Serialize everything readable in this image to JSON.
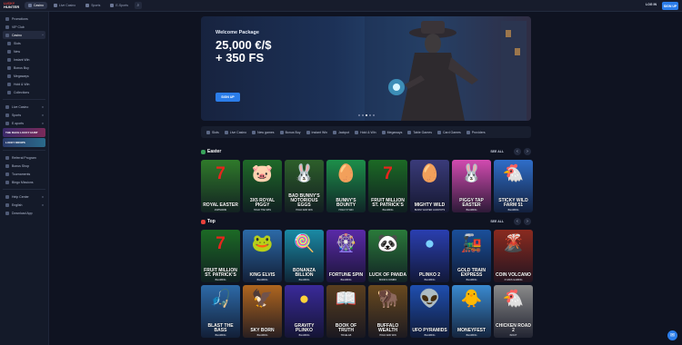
{
  "header": {
    "logo_top": "LUCKY",
    "logo_bottom": "HUNTER",
    "tabs": [
      {
        "label": "Casino",
        "active": true
      },
      {
        "label": "Live Casino",
        "active": false
      },
      {
        "label": "Sports",
        "active": false
      },
      {
        "label": "E-Sports",
        "active": false
      }
    ],
    "login_label": "LOG IN",
    "signup_label": "SIGN UP"
  },
  "sidebar": {
    "items": [
      {
        "label": "Promotions"
      },
      {
        "label": "VIP Club"
      },
      {
        "label": "Casino",
        "active": true,
        "chevron": "^"
      },
      {
        "label": "Slots",
        "sub": true
      },
      {
        "label": "New",
        "sub": true
      },
      {
        "label": "Instant Win",
        "sub": true
      },
      {
        "label": "Bonus Buy",
        "sub": true
      },
      {
        "label": "Megaways",
        "sub": true
      },
      {
        "label": "Hold & Win",
        "sub": true
      },
      {
        "label": "Collections",
        "sub": true
      }
    ],
    "items2": [
      {
        "label": "Live Casino",
        "chevron": "v"
      },
      {
        "label": "Sports",
        "chevron": "v"
      },
      {
        "label": "E-sports",
        "chevron": "v"
      }
    ],
    "promo1": "THE RACE   LUCKY HUNT",
    "promo2": "LUCKY DROPS",
    "items3": [
      {
        "label": "Referral Program"
      },
      {
        "label": "Bonus Shop"
      },
      {
        "label": "Tournaments"
      },
      {
        "label": "Bingo Missions"
      }
    ],
    "items4": [
      {
        "label": "Help Center",
        "chevron": "v"
      },
      {
        "label": "English",
        "chevron": "v"
      },
      {
        "label": "Download App"
      }
    ]
  },
  "hero": {
    "subtitle": "Welcome Package",
    "headline": "25,000 €/$\n+ 350 FS",
    "cta": "SIGN UP"
  },
  "filters": [
    "Slots",
    "Live Casino",
    "New games",
    "Bonus Buy",
    "Instant Win",
    "Jackpot",
    "Hold & Win",
    "Megaways",
    "Table Games",
    "Card Games",
    "Providers"
  ],
  "sections": {
    "easter": {
      "title": "Easter",
      "see_all": "SEE ALL"
    },
    "top": {
      "title": "Top",
      "see_all": "SEE ALL"
    }
  },
  "easter_games": [
    {
      "name": "ROYAL EASTER",
      "provider": "1SPIN4WIN",
      "glyph": "7",
      "bg": "#2f7a2a",
      "fg": "#e8251d"
    },
    {
      "name": "3X5 ROYAL PIGGY",
      "provider": "HOLD THE SPIN",
      "glyph": "🐷",
      "bg": "#1f6a28",
      "fg": "#ffd23a"
    },
    {
      "name": "BAD BUNNY'S NOTORIOUS EGGS",
      "provider": "HOLD AND WIN",
      "glyph": "🐰",
      "bg": "#2d5f2a",
      "fg": "#ffffff"
    },
    {
      "name": "BUNNY'S BOUNTY",
      "provider": "HOLD 'N' WIN",
      "glyph": "🥚",
      "bg": "#1d8f4a",
      "fg": "#f5e34a"
    },
    {
      "name": "FRUIT MILLION ST. PATRICK'S",
      "provider": "BGAMING",
      "glyph": "7",
      "bg": "#1c6a25",
      "fg": "#e8251d"
    },
    {
      "name": "MIGHTY WILD",
      "provider": "BUNNY EASTER JACKPOTS",
      "glyph": "🥚",
      "bg": "#3a3b7a",
      "fg": "#d36be0"
    },
    {
      "name": "PIGGY TAP EASTER",
      "provider": "BGAMING",
      "glyph": "🐰",
      "bg": "#d24bb0",
      "fg": "#ffffff"
    },
    {
      "name": "STICKY WILD FARM 51",
      "provider": "BGAMING",
      "glyph": "🐔",
      "bg": "#2f6ec9",
      "fg": "#ffffff"
    }
  ],
  "top_games_1": [
    {
      "name": "FRUIT MILLION ST. PATRICK'S",
      "provider": "BGAMING",
      "glyph": "7",
      "bg": "#1c6a25",
      "fg": "#e8251d"
    },
    {
      "name": "KING ELVIS",
      "provider": "BGAMING",
      "glyph": "🐸",
      "bg": "#2c6aa8",
      "fg": "#6bd14a"
    },
    {
      "name": "BONANZA BILLION",
      "provider": "BGAMING",
      "glyph": "🍭",
      "bg": "#1a8aa5",
      "fg": "#ff5aa8"
    },
    {
      "name": "FORTUNE SPIN",
      "provider": "BGAMING",
      "glyph": "🎡",
      "bg": "#5a2aa8",
      "fg": "#ffd23a"
    },
    {
      "name": "LUCK OF PANDA",
      "provider": "BONUS COMBO",
      "glyph": "🐼",
      "bg": "#2a7a3a",
      "fg": "#ffffff"
    },
    {
      "name": "PLINKO 2",
      "provider": "BGAMING",
      "glyph": "●",
      "bg": "#2a3fb0",
      "fg": "#7ad0ff"
    },
    {
      "name": "GOLD TRAIN EXPRESS",
      "provider": "BGAMING",
      "glyph": "🚂",
      "bg": "#1a4f9a",
      "fg": "#ffd23a"
    },
    {
      "name": "COIN VOLCANO",
      "provider": "3 OAKS GAMING",
      "glyph": "🌋",
      "bg": "#8a2a1f",
      "fg": "#ffb23a"
    }
  ],
  "top_games_2": [
    {
      "name": "BLAST THE BASS",
      "provider": "BGAMING",
      "glyph": "🎣",
      "bg": "#2d6aa8",
      "fg": "#ffffff"
    },
    {
      "name": "SKY BORN",
      "provider": "BGAMING",
      "glyph": "🦅",
      "bg": "#b0661f",
      "fg": "#ffe3a0"
    },
    {
      "name": "GRAVITY PLINKO",
      "provider": "BGAMING",
      "glyph": "●",
      "bg": "#3a2a9a",
      "fg": "#ffd23a"
    },
    {
      "name": "BOOK OF TRUTH",
      "provider": "TRUELAB",
      "glyph": "📖",
      "bg": "#5a3f1f",
      "fg": "#ffd23a"
    },
    {
      "name": "BUFFALO WEALTH",
      "provider": "HOLD AND WIN",
      "glyph": "🦬",
      "bg": "#6a4a1f",
      "fg": "#ffd23a"
    },
    {
      "name": "UFO PYRAMIDS",
      "provider": "BGAMING",
      "glyph": "👽",
      "bg": "#1f4fb0",
      "fg": "#ffd23a"
    },
    {
      "name": "MONEYFEST",
      "provider": "BGAMING",
      "glyph": "🐥",
      "bg": "#3a8ad0",
      "fg": "#ffd23a"
    },
    {
      "name": "CHICKEN ROAD 2",
      "provider": "INOUT",
      "glyph": "🐔",
      "bg": "#8a8a8a",
      "fg": "#ffffff"
    }
  ],
  "icons": {
    "search": "search-icon",
    "chat": "chat-icon"
  },
  "colors": {
    "accent": "#2b7de9",
    "background": "#0f1321",
    "sidebar": "#141a29"
  }
}
